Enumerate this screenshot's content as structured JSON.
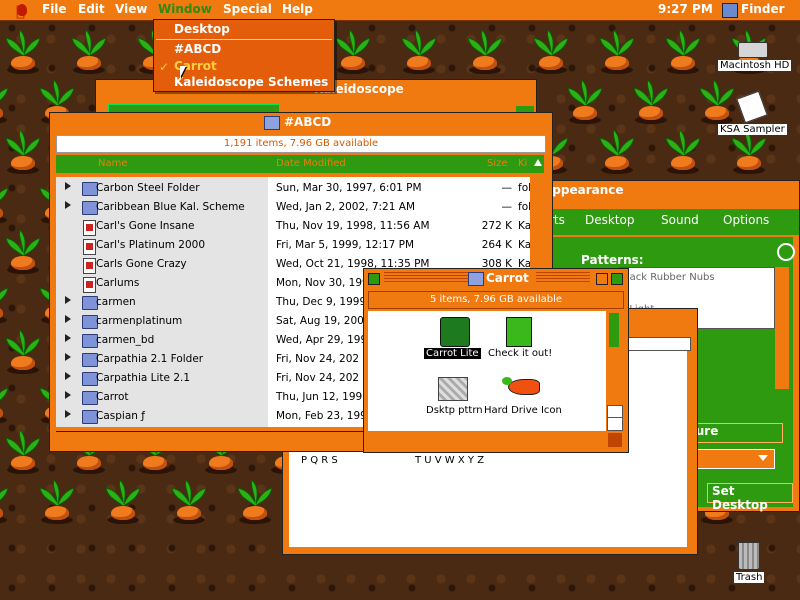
{
  "menubar": {
    "items": [
      "File",
      "Edit",
      "View",
      "Window",
      "Special",
      "Help"
    ],
    "clock": "9:27 PM",
    "app": "Finder"
  },
  "window_menu": {
    "items": [
      "Desktop",
      "#ABCD",
      "Carrot",
      "Kaleidoscope Schemes"
    ],
    "checked": "Carrot"
  },
  "desktop": {
    "icons": [
      {
        "label": "Macintosh HD",
        "icon": "hard-drive-icon"
      },
      {
        "label": "KSA Sampler",
        "icon": "document-icon"
      },
      {
        "label": "Trash",
        "icon": "trash-icon"
      }
    ]
  },
  "kaleidoscope_window": {
    "title": "Kaleidoscope"
  },
  "abcd_window": {
    "title": "#ABCD",
    "status": "1,191 items, 7.96 GB available",
    "columns": [
      "Name",
      "Date Modified",
      "Size",
      "Ki"
    ],
    "rows": [
      {
        "name": "Carbon Steel Folder",
        "date": "Sun, Mar 30, 1997, 6:01 PM",
        "size": "—",
        "kind": "fol",
        "type": "folder"
      },
      {
        "name": "Caribbean Blue Kal. Scheme",
        "date": "Wed, Jan 2, 2002, 7:21 AM",
        "size": "—",
        "kind": "fol",
        "type": "folder"
      },
      {
        "name": "Carl's Gone Insane",
        "date": "Thu, Nov 19, 1998, 11:56 AM",
        "size": "272 K",
        "kind": "Ka",
        "type": "doc"
      },
      {
        "name": "Carl's Platinum 2000",
        "date": "Fri, Mar 5, 1999, 12:17 PM",
        "size": "264 K",
        "kind": "Ka",
        "type": "doc"
      },
      {
        "name": "Carls Gone Crazy",
        "date": "Wed, Oct 21, 1998, 11:35 PM",
        "size": "308 K",
        "kind": "Ka",
        "type": "doc"
      },
      {
        "name": "Carlums",
        "date": "Mon, Nov 30, 1998",
        "size": "",
        "kind": "",
        "type": "doc"
      },
      {
        "name": "carmen",
        "date": "Thu, Dec 9, 1999",
        "size": "",
        "kind": "",
        "type": "folder"
      },
      {
        "name": "carmenplatinum",
        "date": "Sat, Aug 19, 2000",
        "size": "",
        "kind": "",
        "type": "folder"
      },
      {
        "name": "carmen_bd",
        "date": "Wed, Apr 29, 199",
        "size": "",
        "kind": "",
        "type": "folder"
      },
      {
        "name": "Carpathia 2.1 Folder",
        "date": "Fri, Nov 24, 202",
        "size": "",
        "kind": "",
        "type": "folder"
      },
      {
        "name": "Carpathia Lite 2.1",
        "date": "Fri, Nov 24, 202",
        "size": "",
        "kind": "",
        "type": "folder"
      },
      {
        "name": "Carrot",
        "date": "Thu, Jun 12, 199",
        "size": "",
        "kind": "",
        "type": "folder"
      },
      {
        "name": "Caspian ƒ",
        "date": "Mon, Feb 23, 199",
        "size": "",
        "kind": "",
        "type": "folder"
      }
    ]
  },
  "appearance_window": {
    "title": "Appearance",
    "tabs": [
      "rts",
      "Desktop",
      "Sound",
      "Options"
    ],
    "patterns_label": "Patterns:",
    "patterns_list": [
      "Black Rubber Nubs",
      "k",
      "e Light"
    ],
    "picture_button": "ture",
    "set_desktop": "Set Desktop"
  },
  "behind_window": {
    "letters_left": "P Q R S",
    "letters_right": "T U V W X Y Z"
  },
  "carrot_window": {
    "title": "Carrot",
    "status": "5 items, 7.96 GB available",
    "items": [
      {
        "label": "Carrot Lite",
        "icon": "app-icon",
        "selected": true
      },
      {
        "label": "Check it out!",
        "icon": "document-icon",
        "selected": false
      },
      {
        "label": "Dsktp pttrn",
        "icon": "pattern-icon",
        "selected": false
      },
      {
        "label": "Hard Drive Icon",
        "icon": "carrot-icon",
        "selected": false
      }
    ]
  }
}
